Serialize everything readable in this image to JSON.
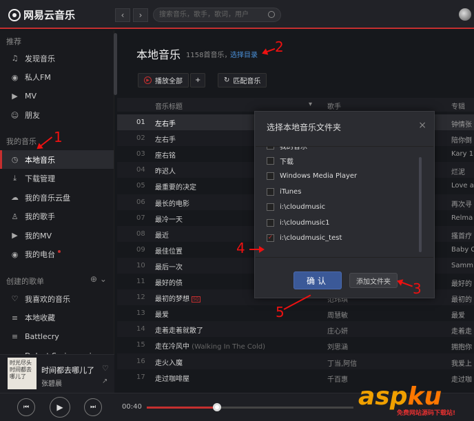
{
  "app": {
    "logo": "网易云音乐",
    "search_placeholder": "搜索音乐，歌手，歌词，用户"
  },
  "sidebar": {
    "sec_recommend": "推荐",
    "recommend": [
      {
        "label": "发现音乐",
        "icon": "music-note-icon"
      },
      {
        "label": "私人FM",
        "icon": "radio-icon"
      },
      {
        "label": "MV",
        "icon": "video-icon"
      },
      {
        "label": "朋友",
        "icon": "friends-icon"
      }
    ],
    "sec_mymusic": "我的音乐",
    "mymusic": [
      {
        "label": "本地音乐",
        "icon": "clock-icon"
      },
      {
        "label": "下载管理",
        "icon": "download-icon"
      },
      {
        "label": "我的音乐云盘",
        "icon": "cloud-icon"
      },
      {
        "label": "我的歌手",
        "icon": "singer-icon"
      },
      {
        "label": "我的MV",
        "icon": "video-icon"
      },
      {
        "label": "我的电台",
        "icon": "radio-icon"
      }
    ],
    "sec_playlists": "创建的歌单",
    "playlists": [
      {
        "label": "我喜欢的音乐",
        "icon": "heart-icon"
      },
      {
        "label": "本地收藏",
        "icon": "playlist-icon"
      },
      {
        "label": "Battlecry",
        "icon": "playlist-icon"
      },
      {
        "label": "Dulcet Series spring sp",
        "icon": "playlist-icon"
      }
    ]
  },
  "main": {
    "title": "本地音乐",
    "count": "1158首音乐，",
    "choose_dir": "选择目录",
    "play_all": "播放全部",
    "add": "+",
    "match": "匹配音乐",
    "headers": {
      "title": "音乐标题",
      "artist": "歌手",
      "album": "专辑"
    },
    "rows": [
      {
        "n": "01",
        "title": "左右手",
        "sub": "",
        "artist": "",
        "album": "钟情张"
      },
      {
        "n": "02",
        "title": "左右手",
        "sub": "",
        "artist": "",
        "album": "陪你倒"
      },
      {
        "n": "03",
        "title": "座右铭",
        "sub": "",
        "artist": "",
        "album": "Kary 1"
      },
      {
        "n": "04",
        "title": "昨迟人",
        "sub": "",
        "artist": "",
        "album": "烂泥"
      },
      {
        "n": "05",
        "title": "最重要的决定",
        "sub": "",
        "artist": "",
        "album": "Love ar"
      },
      {
        "n": "06",
        "title": "最长的电影",
        "sub": "",
        "artist": "",
        "album": "再次寻"
      },
      {
        "n": "07",
        "title": "最冷一天",
        "sub": "",
        "artist": "",
        "album": "Relma"
      },
      {
        "n": "08",
        "title": "最近",
        "sub": "",
        "artist": "",
        "album": "搔首疗"
      },
      {
        "n": "09",
        "title": "最佳位置",
        "sub": "",
        "artist": "",
        "album": "Baby C"
      },
      {
        "n": "10",
        "title": "最后一次",
        "sub": "",
        "artist": "",
        "album": "Samm"
      },
      {
        "n": "11",
        "title": "最好的债",
        "sub": "",
        "artist": "",
        "album": "最好的"
      },
      {
        "n": "12",
        "title": "最初的梦想",
        "sub": "",
        "tag": "SQ",
        "artist": "范玮琪",
        "album": "最初的"
      },
      {
        "n": "13",
        "title": "最爱",
        "sub": "",
        "artist": "周慧敏",
        "album": "最爱"
      },
      {
        "n": "14",
        "title": "走着走着就散了",
        "sub": "",
        "artist": "庄心妍",
        "album": "走着走"
      },
      {
        "n": "15",
        "title": "走在冷风中",
        "sub": "(Walking In The Cold)",
        "artist": "刘思涵",
        "album": "拥抱你"
      },
      {
        "n": "16",
        "title": "走火入魔",
        "sub": "",
        "artist": "丁当,阿信",
        "album": "我爱上"
      },
      {
        "n": "17",
        "title": "走过咖啡屋",
        "sub": "",
        "artist": "千百惠",
        "album": "走过咖"
      }
    ]
  },
  "dialog": {
    "title": "选择本地音乐文件夹",
    "close": "×",
    "items": [
      {
        "label": "我的音乐",
        "checked": false
      },
      {
        "label": "下载",
        "checked": false
      },
      {
        "label": "Windows Media Player",
        "checked": false
      },
      {
        "label": "iTunes",
        "checked": false
      },
      {
        "label": "i:\\cloudmusic",
        "checked": false
      },
      {
        "label": "i:\\cloudmusic1",
        "checked": false
      },
      {
        "label": "i:\\cloudmusic_test",
        "checked": true
      }
    ],
    "ok": "确认",
    "add_folder": "添加文件夹"
  },
  "now_playing": {
    "song": "时间都去哪儿了",
    "artist": "张碧晨",
    "cover_text": "时光尽头 时间都去哪儿了",
    "elapsed": "00:40",
    "progress": 0.34
  },
  "annotations": [
    "1",
    "2",
    "3",
    "4",
    "5"
  ],
  "watermark": {
    "brand_a": "asp",
    "brand_b": "ku",
    ".com": ".com",
    "sub": "免费网站源码下载站!"
  },
  "colors": {
    "accent": "#c62f2f",
    "confirm": "#3b5998"
  }
}
